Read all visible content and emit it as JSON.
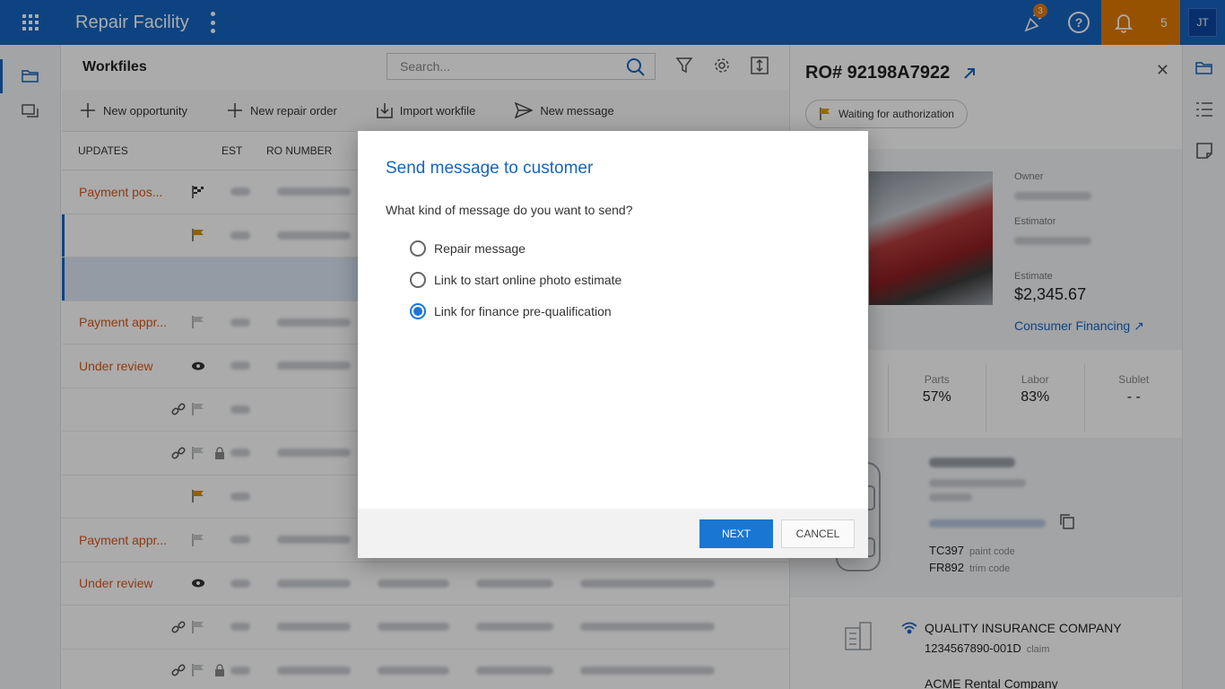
{
  "header": {
    "app_title": "Repair Facility",
    "notifications_badge": "3",
    "alerts_count": "5",
    "user_initials": "JT"
  },
  "icons": {
    "apps": "grid-icon",
    "menu": "kebab-icon",
    "celebrate": "party-icon",
    "help": "help-icon",
    "bell": "bell-icon"
  },
  "workfiles": {
    "title": "Workfiles",
    "search_placeholder": "Search...",
    "actions": [
      "New opportunity",
      "New repair order",
      "Import workfile",
      "New message"
    ],
    "columns": {
      "updates": "UPDATES",
      "est": "EST",
      "ro_number": "RO NUMBER"
    },
    "rows": [
      {
        "update": "Payment pos...",
        "icon": "checkered-flag"
      },
      {
        "update": "",
        "icon": "flag-orange"
      },
      {
        "update": "",
        "icon": ""
      },
      {
        "update": "Payment appr...",
        "icon": "flag-grey"
      },
      {
        "update": "Under review",
        "icon": "eye"
      },
      {
        "update": "",
        "icon": "link-flag"
      },
      {
        "update": "",
        "icon": "link-flag-lock"
      },
      {
        "update": "",
        "icon": "flag-orange"
      },
      {
        "update": "Payment appr...",
        "icon": "flag-grey"
      },
      {
        "update": "Under review",
        "icon": "eye"
      },
      {
        "update": "",
        "icon": "link-flag"
      },
      {
        "update": "",
        "icon": "link-flag-lock"
      }
    ]
  },
  "detail": {
    "ro_title": "RO# 92198A7922",
    "status": "Waiting for authorization",
    "owner_label": "Owner",
    "estimator_label": "Estimator",
    "estimate_label": "Estimate",
    "estimate_value": "$2,345.67",
    "financing_link": "Consumer Financing",
    "stats": [
      {
        "label": "Parts",
        "value": "57%"
      },
      {
        "label": "Labor",
        "value": "83%"
      },
      {
        "label": "Sublet",
        "value": "- -"
      }
    ],
    "paint_code": "TC397",
    "paint_label": "paint code",
    "trim_code": "FR892",
    "trim_label": "trim code",
    "insurance": "QUALITY INSURANCE COMPANY",
    "claim_number": "1234567890-001D",
    "claim_label": "claim",
    "rental": "ACME Rental Company"
  },
  "modal": {
    "title": "Send message to customer",
    "question": "What kind of message do you want to send?",
    "options": [
      {
        "label": "Repair message",
        "checked": false
      },
      {
        "label": "Link to start online photo estimate",
        "checked": false
      },
      {
        "label": "Link for finance pre-qualification",
        "checked": true
      }
    ],
    "next_label": "NEXT",
    "cancel_label": "CANCEL"
  },
  "colors": {
    "primary": "#1565c0",
    "accent_orange": "#e07b00",
    "update_text": "#d9561a"
  }
}
